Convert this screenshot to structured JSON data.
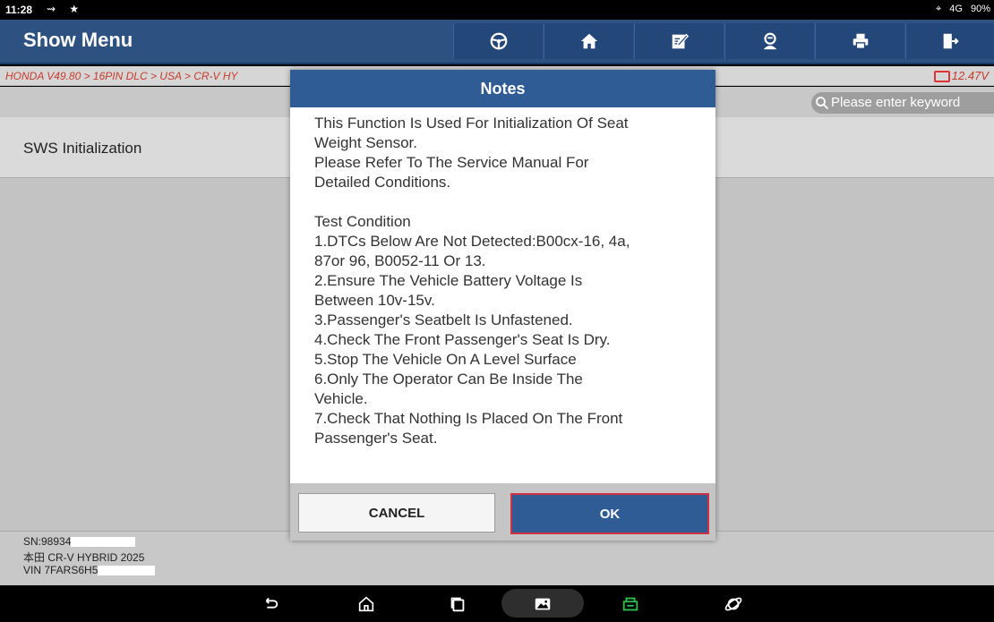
{
  "status_bar": {
    "time": "11:28",
    "left_icons": "⇝ ★",
    "right_text": {
      "location": "⌖",
      "network": "4G",
      "battery": "90%"
    }
  },
  "header": {
    "title": "Show Menu"
  },
  "breadcrumb": {
    "path": "HONDA V49.80 > 16PIN DLC > USA > CR-V HY",
    "voltage": "12.47V"
  },
  "search": {
    "placeholder": "Please enter keyword"
  },
  "menu": {
    "items": [
      {
        "label": "SWS Initialization"
      }
    ]
  },
  "vehicle_info": {
    "sn": "SN:98934",
    "model": "本田 CR-V HYBRID 2025",
    "vin": "VIN 7FARS6H5"
  },
  "dialog": {
    "title": "Notes",
    "body": "This Function Is Used For Initialization Of Seat\nWeight Sensor.\nPlease Refer To The Service Manual For\nDetailed Conditions.\n\nTest Condition\n1.DTCs Below Are Not Detected:B00cx-16, 4a,\n87or 96, B0052-11 Or 13.\n2.Ensure The Vehicle Battery Voltage Is\nBetween 10v-15v.\n3.Passenger's Seatbelt Is Unfastened.\n4.Check The Front Passenger's Seat Is Dry.\n5.Stop The Vehicle On A Level Surface\n6.Only The Operator Can Be Inside The\nVehicle.\n7.Check That Nothing Is Placed On The Front\nPassenger's Seat.",
    "cancel_label": "CANCEL",
    "ok_label": "OK"
  },
  "icons": {
    "nav": [
      "steering-wheel-icon",
      "home-icon",
      "edit-icon",
      "user-icon",
      "print-icon",
      "exit-icon"
    ],
    "android": [
      "back-icon",
      "house-icon",
      "recents-icon",
      "gallery-icon",
      "vci-icon",
      "browser-icon"
    ]
  },
  "colors": {
    "header_bg": "#2d5282",
    "dialog_header": "#2f5c95",
    "breadcrumb_text": "#c73a2a",
    "ok_border": "#d0303f",
    "vci_icon": "#2fbf4f"
  }
}
